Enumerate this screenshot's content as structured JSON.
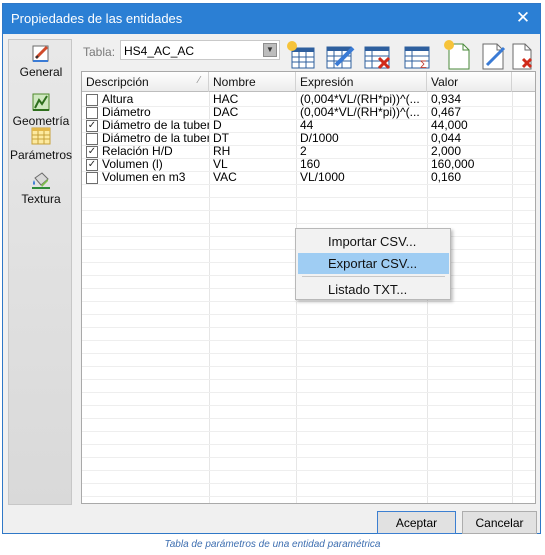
{
  "window": {
    "title": "Propiedades de las entidades",
    "close_glyph": "✕"
  },
  "sidebar": {
    "items": [
      {
        "label": "General",
        "icon": "general-pencil-icon"
      },
      {
        "label": "Geometría",
        "icon": "geometry-ruler-icon"
      },
      {
        "label": "Parámetros",
        "icon": "parameters-table-icon"
      },
      {
        "label": "Textura",
        "icon": "texture-bucket-icon"
      }
    ],
    "selected": "Parámetros"
  },
  "toolbar": {
    "tabla_label": "Tabla:",
    "tabla_value": "HS4_AC_AC",
    "buttons": [
      "new-table-icon",
      "edit-table-icon",
      "delete-table-icon",
      "sum-table-icon",
      "new-document-icon",
      "edit-document-icon",
      "delete-document-icon"
    ]
  },
  "grid": {
    "columns": [
      "Descripción",
      "Nombre",
      "Expresión",
      "Valor"
    ],
    "sort_glyph": "⁄",
    "rows": [
      {
        "checked": false,
        "desc": "Altura",
        "name": "HAC",
        "expr": "(0,004*VL/(RH*pi))^(...",
        "value": "0,934"
      },
      {
        "checked": false,
        "desc": "Diámetro",
        "name": "DAC",
        "expr": "(0,004*VL/(RH*pi))^(...",
        "value": "0,467"
      },
      {
        "checked": true,
        "desc": "Diámetro de la tubería",
        "name": "D",
        "expr": "44",
        "value": "44,000"
      },
      {
        "checked": false,
        "desc": "Diámetro de la tuber...",
        "name": "DT",
        "expr": "D/1000",
        "value": "0,044"
      },
      {
        "checked": true,
        "desc": "Relación H/D",
        "name": "RH",
        "expr": "2",
        "value": "2,000"
      },
      {
        "checked": true,
        "desc": "Volumen (l)",
        "name": "VL",
        "expr": "160",
        "value": "160,000"
      },
      {
        "checked": false,
        "desc": "Volumen en m3",
        "name": "VAC",
        "expr": "VL/1000",
        "value": "0,160"
      }
    ]
  },
  "context_menu": {
    "items": [
      "Importar CSV...",
      "Exportar CSV...",
      "Listado TXT..."
    ],
    "highlighted": "Exportar CSV..."
  },
  "footer": {
    "accept": "Aceptar",
    "cancel": "Cancelar"
  },
  "caption": "Tabla de parámetros de una entidad paramétrica",
  "colors": {
    "titlebar": "#2b7fd4",
    "highlight": "#9fcdf3",
    "caption": "#3d6eb0"
  }
}
